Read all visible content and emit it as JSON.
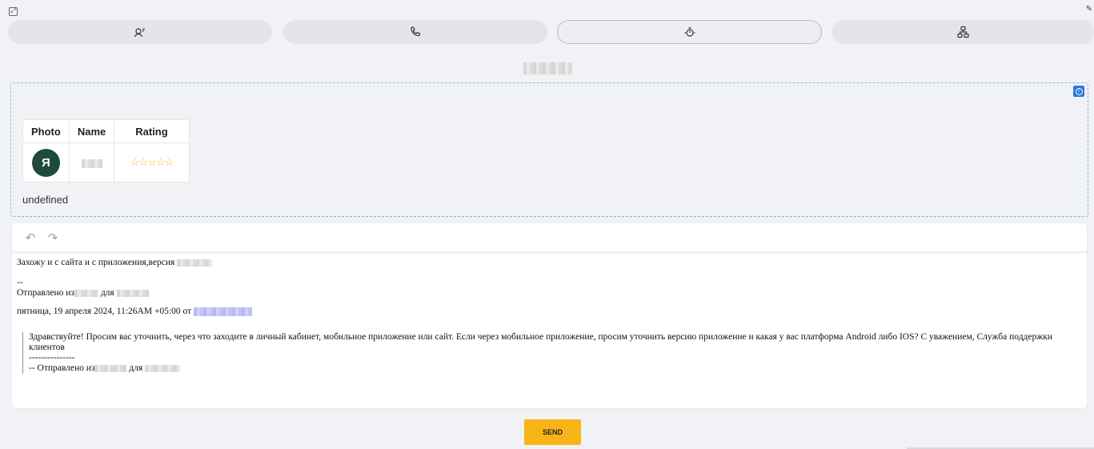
{
  "tabs": [
    {
      "icon": "agent-icon",
      "active": false
    },
    {
      "icon": "phone-icon",
      "active": false
    },
    {
      "icon": "timer-icon",
      "active": true
    },
    {
      "icon": "flow-icon",
      "active": false
    }
  ],
  "agent_table": {
    "headers": [
      "Photo",
      "Name",
      "Rating"
    ],
    "row": {
      "avatar_letter": "Я",
      "rating_stars": "☆☆☆☆☆"
    }
  },
  "panel_footer_text": "undefined",
  "message": {
    "line1": "Захожу и с сайта и с приложения,версия",
    "separator": "--",
    "sent_from_prefix": "Отправлено из",
    "sent_from_for": "для",
    "date_line": "пятница, 19 апреля 2024, 11:26AM +05:00 от",
    "quote_text": "Здравствуйте! Просим вас уточнить, через что заходите в личный кабинет, мобильное приложение или сайт. Если через мобильное приложение, просим уточнить версию приложение и какая у вас платформа Android либо IOS? С уважением, Служба поддержки клиентов",
    "quote_dashes": "---------------",
    "quote_sent_prefix": "-- Отправлено из",
    "quote_sent_for": "для"
  },
  "send_label": "SEND",
  "colors": {
    "accent": "#f8b417",
    "avatar_bg": "#1f4a3e",
    "info_btn": "#2b79d8"
  }
}
